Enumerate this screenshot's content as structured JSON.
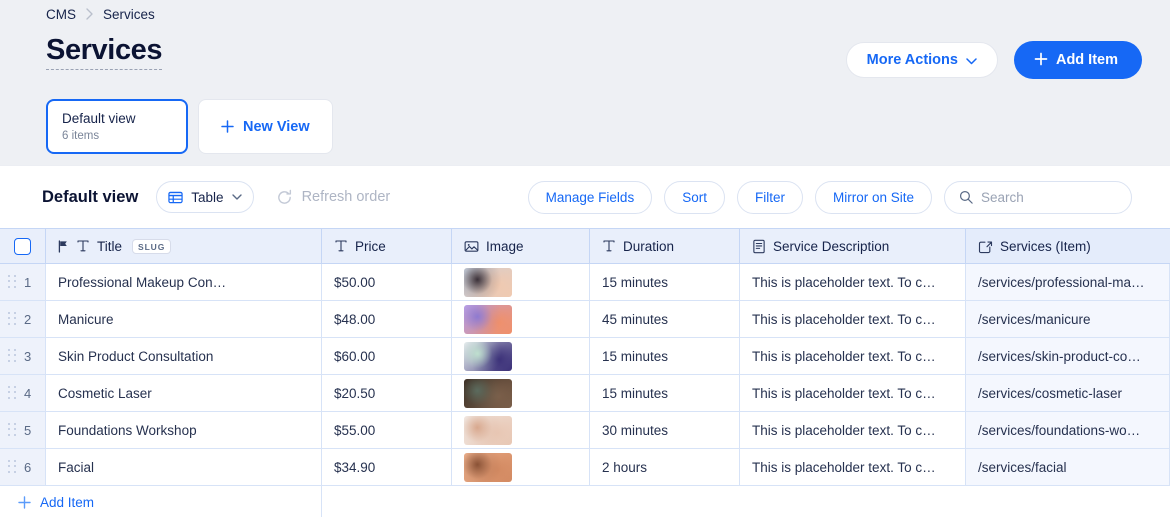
{
  "breadcrumb": {
    "root": "CMS",
    "current": "Services"
  },
  "header": {
    "title": "Services",
    "more_actions_label": "More Actions",
    "add_item_label": "Add Item"
  },
  "views": {
    "default_view": {
      "name": "Default view",
      "count_label": "6 items"
    },
    "new_view_label": "New View"
  },
  "toolbar": {
    "view_title": "Default view",
    "layout_label": "Table",
    "refresh_label": "Refresh order",
    "manage_fields_label": "Manage Fields",
    "sort_label": "Sort",
    "filter_label": "Filter",
    "mirror_label": "Mirror on Site",
    "search_placeholder": "Search",
    "search_value": ""
  },
  "table": {
    "columns": [
      {
        "key": "num",
        "label": "",
        "icon": ""
      },
      {
        "key": "title",
        "label": "Title",
        "icon": "text-field-icon",
        "badge": "SLUG"
      },
      {
        "key": "price",
        "label": "Price",
        "icon": "text-field-icon"
      },
      {
        "key": "image",
        "label": "Image",
        "icon": "image-field-icon"
      },
      {
        "key": "duration",
        "label": "Duration",
        "icon": "text-field-icon"
      },
      {
        "key": "description",
        "label": "Service Description",
        "icon": "rich-text-field-icon"
      },
      {
        "key": "slug",
        "label": "Services (Item)",
        "icon": "reference-field-icon"
      }
    ],
    "rows": [
      {
        "num": "1",
        "title": "Professional Makeup Con…",
        "price": "$50.00",
        "duration": "15 minutes",
        "description": "This is placeholder text. To c…",
        "slug": "/services/professional-ma…",
        "thumb": [
          "#c8d2e0",
          "#f0c9b0",
          "#3b3139"
        ]
      },
      {
        "num": "2",
        "title": "Manicure",
        "price": "$48.00",
        "duration": "45 minutes",
        "description": "This is placeholder text. To c…",
        "slug": "/services/manicure",
        "thumb": [
          "#b9a2e8",
          "#f0906a",
          "#8e7ad1"
        ]
      },
      {
        "num": "3",
        "title": "Skin Product Consultation",
        "price": "$60.00",
        "duration": "15 minutes",
        "description": "This is placeholder text. To c…",
        "slug": "/services/skin-product-co…",
        "thumb": [
          "#e9eef0",
          "#3a2f78",
          "#bfe0cf"
        ]
      },
      {
        "num": "4",
        "title": "Cosmetic Laser",
        "price": "$20.50",
        "duration": "15 minutes",
        "description": "This is placeholder text. To c…",
        "slug": "/services/cosmetic-laser",
        "thumb": [
          "#3a2a20",
          "#7b5f4a",
          "#5b6b5e"
        ]
      },
      {
        "num": "5",
        "title": "Foundations Workshop",
        "price": "$55.00",
        "duration": "30 minutes",
        "description": "This is placeholder text. To c…",
        "slug": "/services/foundations-wo…",
        "thumb": [
          "#f3eeea",
          "#e8c7b4",
          "#d8a88e"
        ]
      },
      {
        "num": "6",
        "title": "Facial",
        "price": "$34.90",
        "duration": "2 hours",
        "description": "This is placeholder text. To c…",
        "slug": "/services/facial",
        "thumb": [
          "#f2b692",
          "#d38a62",
          "#8a5236"
        ]
      }
    ],
    "add_item_label": "Add Item"
  },
  "colors": {
    "accent": "#1668f5",
    "page_bg": "#eef0f4",
    "header_bg": "#e9effb",
    "grid_line": "#d7e3f7"
  }
}
